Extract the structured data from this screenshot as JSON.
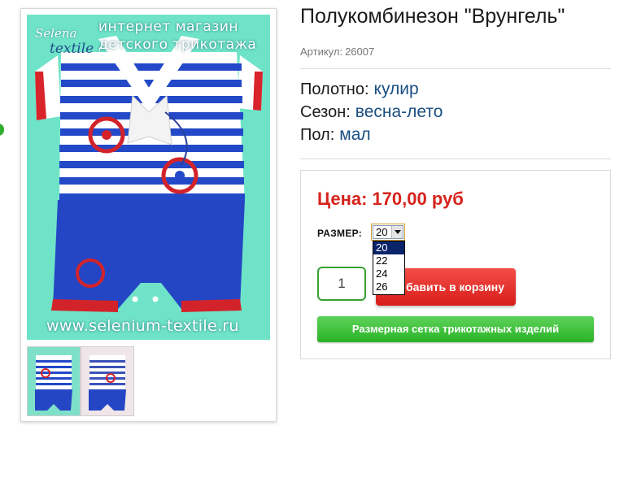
{
  "product": {
    "title": "Полукомбинезон \"Врунгель\"",
    "sku_label": "Артикул:",
    "sku_value": "26007",
    "attributes": [
      {
        "label": "Полотно:",
        "value": "кулир"
      },
      {
        "label": "Сезон:",
        "value": "весна-лето"
      },
      {
        "label": "Пол:",
        "value": "мал"
      }
    ]
  },
  "photo": {
    "brand_line1": "интернет магазин",
    "brand_line2": "детского трикотажа",
    "logo_line1": "Selena",
    "logo_line2": "textile",
    "watermark_url": "www.selenium-textile.ru"
  },
  "buy": {
    "price_label": "Цена:",
    "price_value": "170,00 руб",
    "size_label": "РАЗМЕР:",
    "size_selected": "20",
    "size_options": [
      "20",
      "22",
      "24",
      "26"
    ],
    "quantity": "1",
    "add_to_cart_label": "бавить в корзину",
    "size_chart_label": "Размерная сетка трикотажных изделий"
  },
  "colors": {
    "price": "#d7231c",
    "attribute_value": "#1b4f82",
    "add_to_cart": "#e0302a",
    "size_chart": "#3ec23a",
    "photo_background": "#6fe3c8"
  }
}
